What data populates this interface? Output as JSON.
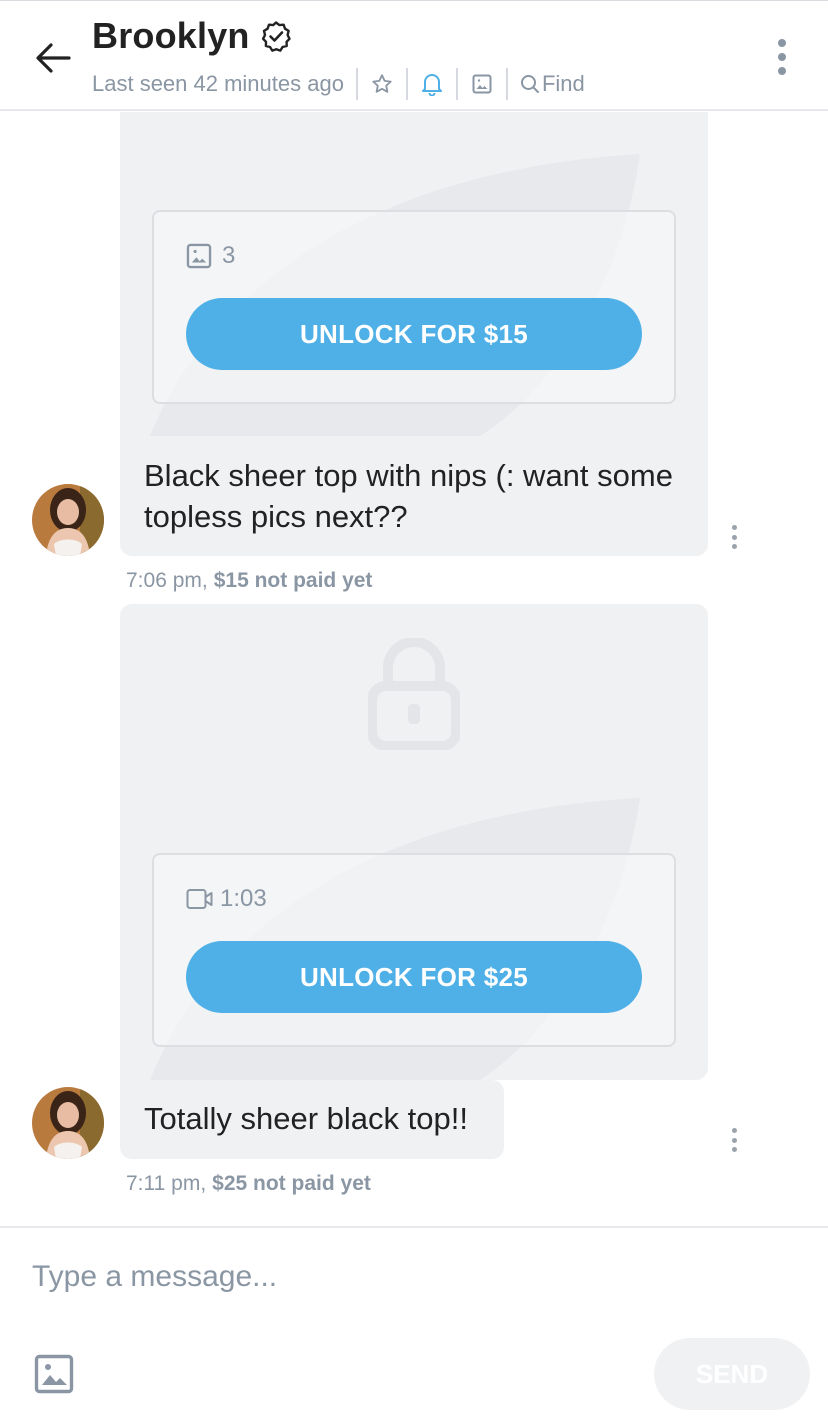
{
  "header": {
    "name": "Brooklyn",
    "last_seen": "Last seen 42 minutes ago",
    "find_label": "Find",
    "accent": "#4fb0e8"
  },
  "messages": [
    {
      "media_kind": "photos",
      "media_count": "3",
      "unlock_label": "UNLOCK FOR $15",
      "text": "Black sheer top with nips (: want some topless pics next??",
      "time": "7:06 pm,",
      "payment": "$15 not paid yet"
    },
    {
      "media_kind": "video",
      "media_count": "1:03",
      "unlock_label": "UNLOCK FOR $25",
      "text": "Totally sheer black top!!",
      "time": "7:11 pm,",
      "payment": "$25 not paid yet"
    }
  ],
  "composer": {
    "placeholder": "Type a message...",
    "send_label": "SEND"
  }
}
